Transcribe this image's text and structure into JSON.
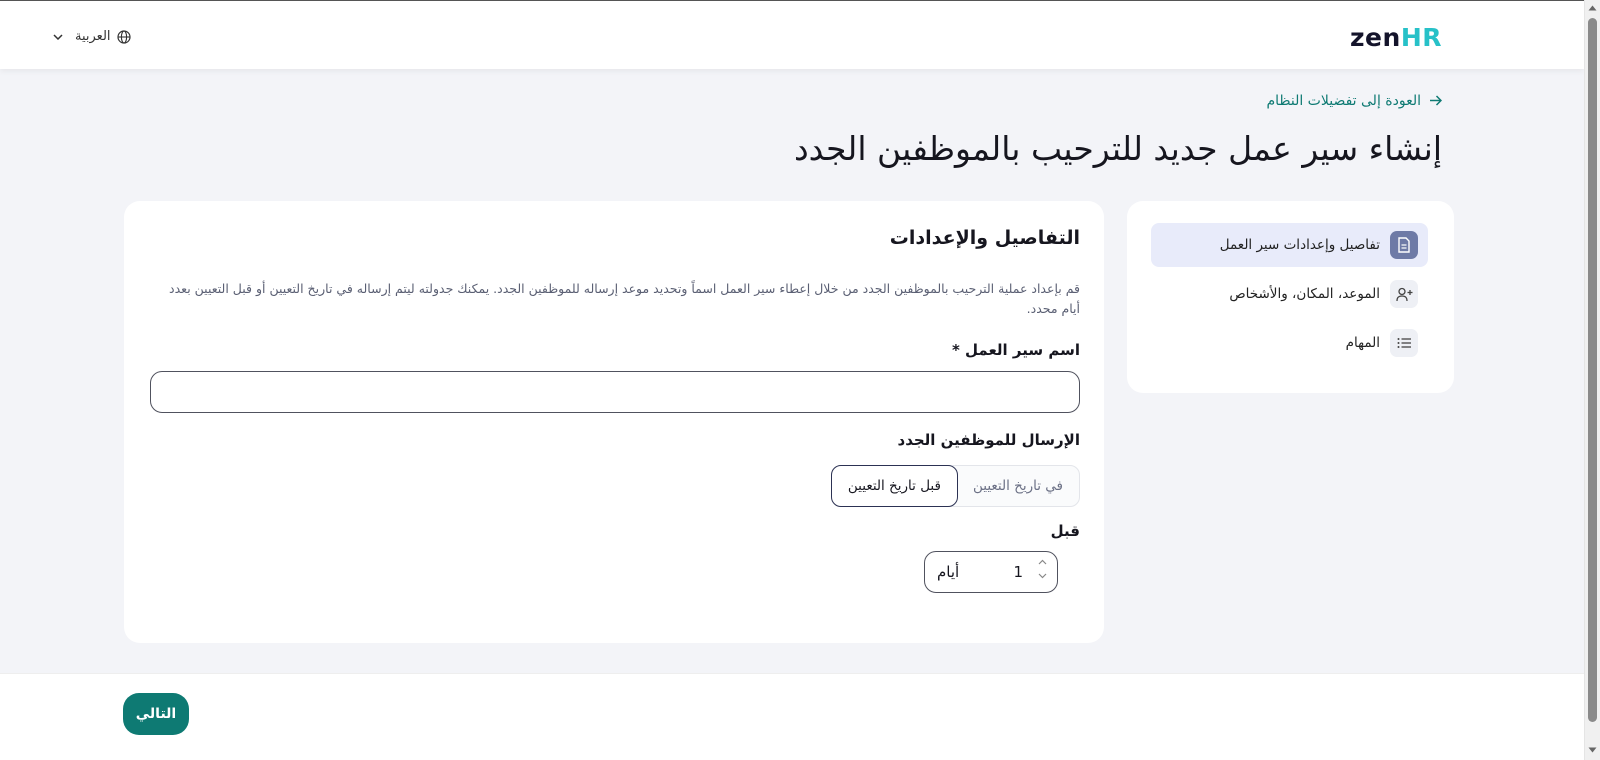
{
  "header": {
    "logo": {
      "zen": "zen",
      "hr": "HR"
    },
    "language": {
      "label": "العربية",
      "icon": "globe-icon",
      "chevron": "chevron-down-icon"
    }
  },
  "back_link": {
    "label": "العودة إلى تفضيلات النظام",
    "icon": "arrow-right-icon"
  },
  "page_title": "إنشاء سير عمل جديد للترحيب بالموظفين الجدد",
  "steps": [
    {
      "label": "تفاصيل وإعدادات سير العمل",
      "icon": "document-icon",
      "active": true
    },
    {
      "label": "الموعد، المكان، والأشخاص",
      "icon": "user-plus-icon",
      "active": false
    },
    {
      "label": "المهام",
      "icon": "list-icon",
      "active": false
    }
  ],
  "form": {
    "section_title": "التفاصيل والإعدادات",
    "description": "قم بإعداد عملية الترحيب بالموظفين الجدد من خلال إعطاء سير العمل اسماً وتحديد موعد إرساله للموظفين الجدد. يمكنك جدولته ليتم إرساله في تاريخ التعيين أو قبل التعيين بعدد أيام محدد.",
    "workflow_name_label": "اسم سير العمل *",
    "workflow_name_value": "",
    "send_label": "الإرسال للموظفين الجدد",
    "send_options": [
      {
        "label": "في تاريخ التعيين",
        "selected": false
      },
      {
        "label": "قبل تاريخ التعيين",
        "selected": true
      }
    ],
    "before_label": "قبل",
    "days_value": "1",
    "days_unit": "أيام"
  },
  "footer": {
    "next_label": "التالي"
  },
  "colors": {
    "accent": "#0e7a73",
    "brand_hr": "#27c1c8",
    "active_step_bg": "#e8ebfa"
  }
}
